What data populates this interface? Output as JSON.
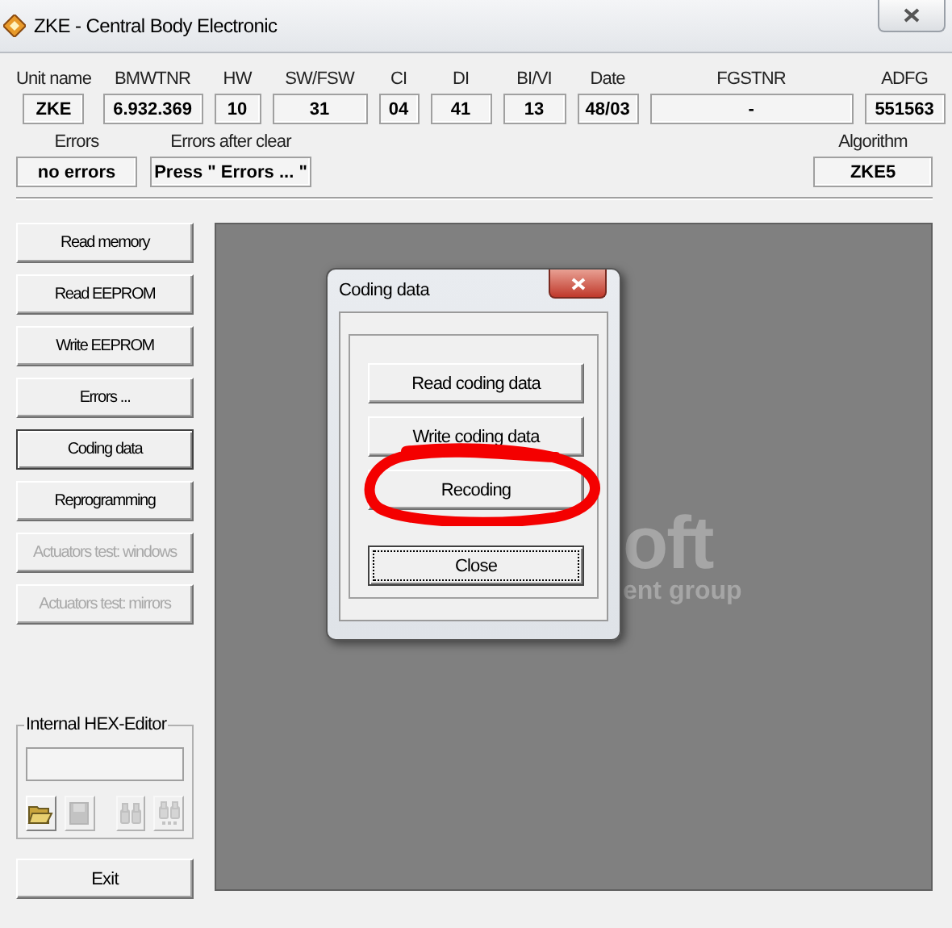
{
  "window": {
    "title": "ZKE - Central Body Electronic"
  },
  "info_fields": [
    {
      "label": "Unit name",
      "value": "ZKE"
    },
    {
      "label": "BMWTNR",
      "value": "6.932.369"
    },
    {
      "label": "HW",
      "value": "10"
    },
    {
      "label": "SW/FSW",
      "value": "31"
    },
    {
      "label": "CI",
      "value": "04"
    },
    {
      "label": "DI",
      "value": "41"
    },
    {
      "label": "BI/VI",
      "value": "13"
    },
    {
      "label": "Date",
      "value": "48/03"
    },
    {
      "label": "FGSTNR",
      "value": "-"
    },
    {
      "label": "ADFG",
      "value": "551563"
    }
  ],
  "error_fields": [
    {
      "label": "Errors",
      "value": "no errors"
    },
    {
      "label": "Errors after clear",
      "value": "Press \" Errors ... \""
    }
  ],
  "algorithm": {
    "label": "Algorithm",
    "value": "ZKE5"
  },
  "side_buttons": [
    {
      "label": "Read memory",
      "disabled": false,
      "focused": false
    },
    {
      "label": "Read EEPROM",
      "disabled": false,
      "focused": false
    },
    {
      "label": "Write EEPROM",
      "disabled": false,
      "focused": false
    },
    {
      "label": "Errors ...",
      "disabled": false,
      "focused": false
    },
    {
      "label": "Coding data",
      "disabled": false,
      "focused": true
    },
    {
      "label": "Reprogramming",
      "disabled": false,
      "focused": false
    },
    {
      "label": "Actuators test: windows",
      "disabled": true,
      "focused": false
    },
    {
      "label": "Actuators test: mirrors",
      "disabled": true,
      "focused": false
    }
  ],
  "hex_editor": {
    "title": "Internal HEX-Editor",
    "tools": [
      {
        "kind": "open",
        "disabled": false
      },
      {
        "kind": "save",
        "disabled": true
      },
      {
        "kind": "find",
        "disabled": true
      },
      {
        "kind": "find-next",
        "disabled": true
      }
    ]
  },
  "exit_button": "Exit",
  "background_logo": {
    "lines": [
      "oft",
      "ent group"
    ]
  },
  "dialog": {
    "title": "Coding data",
    "buttons": [
      {
        "label": "Read coding data",
        "focused": false
      },
      {
        "label": "Write coding data",
        "focused": false
      },
      {
        "label": "Recoding",
        "focused": false
      },
      {
        "label": "Close",
        "focused": true
      }
    ]
  },
  "annotation": {
    "kind": "red-circle"
  }
}
